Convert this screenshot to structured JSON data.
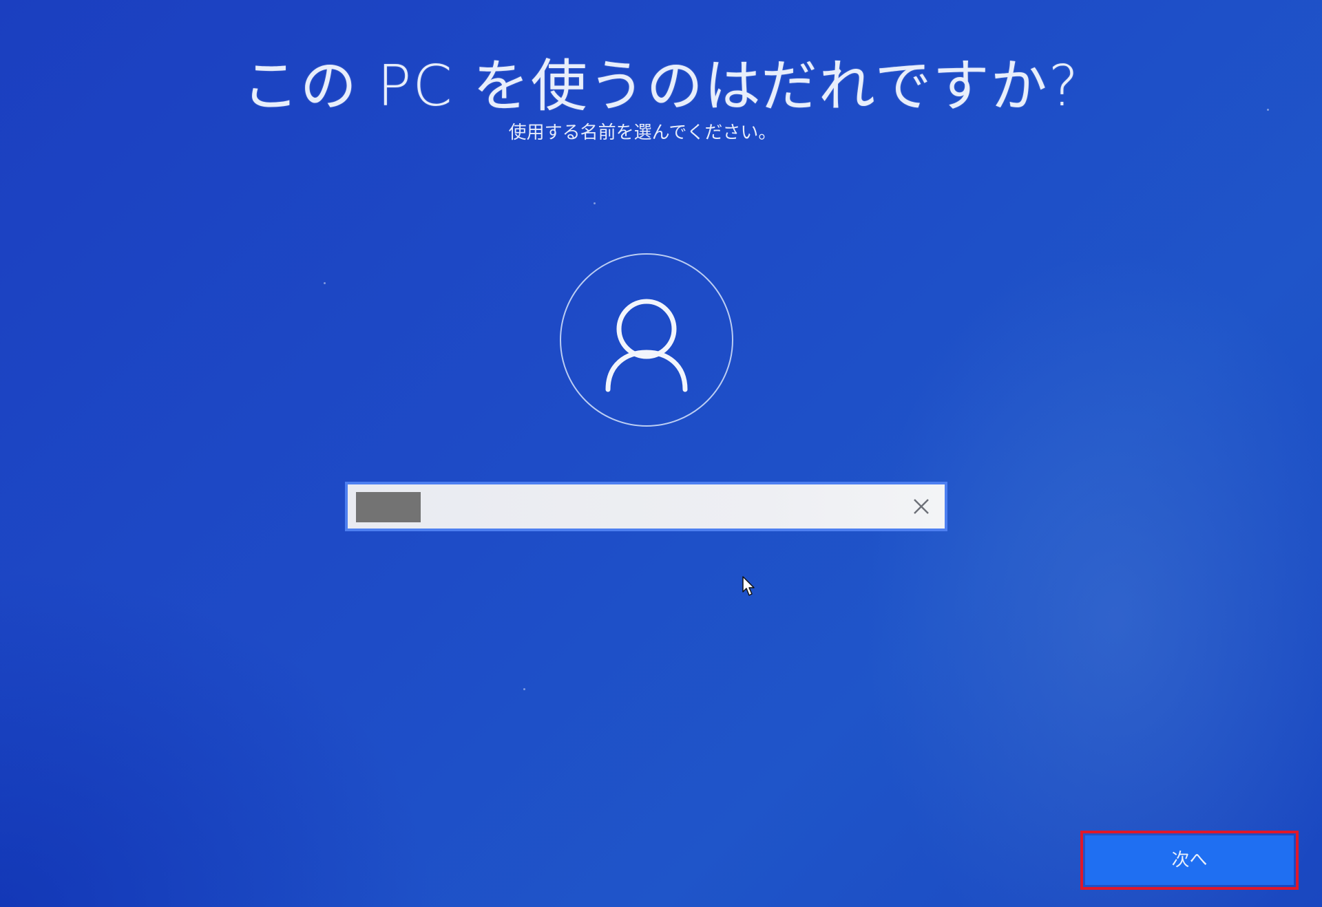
{
  "title": "この PC を使うのはだれですか?",
  "subtitle": "使用する名前を選んでください。",
  "name_field": {
    "value": "",
    "clear_icon": "close-icon"
  },
  "avatar_icon": "user-icon",
  "next_button": {
    "label": "次へ"
  },
  "colors": {
    "background": "#1e4cc7",
    "field_border": "#4d7ff0",
    "button": "#1f6ff2",
    "highlight": "#e0182a"
  }
}
